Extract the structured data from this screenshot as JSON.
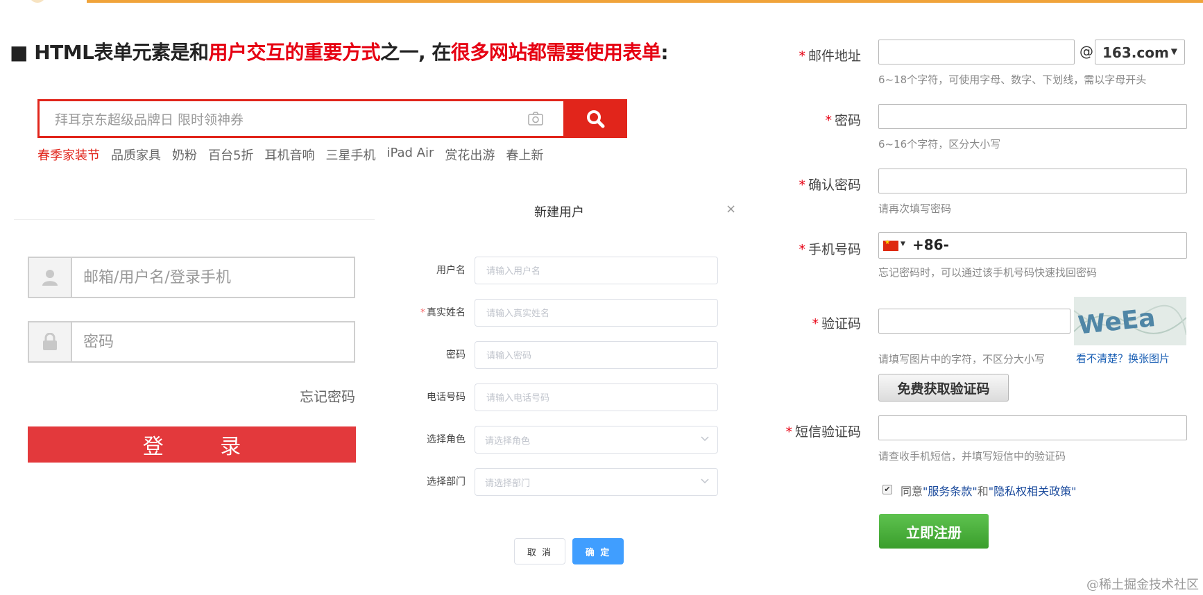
{
  "title": {
    "part1": "HTML表单元素是和",
    "part2": "用户交互的重要方式",
    "part3": "之一, 在",
    "part4": "很多网站都需要使用表单",
    "part5": ":"
  },
  "jd_search": {
    "placeholder": "拜耳京东超级品牌日 限时领神券",
    "hot_words": [
      "春季家装节",
      "品质家具",
      "奶粉",
      "百台5折",
      "耳机音响",
      "三星手机",
      "iPad Air",
      "赏花出游",
      "春上新"
    ]
  },
  "login": {
    "username_placeholder": "邮箱/用户名/登录手机",
    "password_placeholder": "密码",
    "forgot_password": "忘记密码",
    "login_button": "登 录"
  },
  "dialog": {
    "title": "新建用户",
    "close": "×",
    "fields": [
      {
        "label": "用户名",
        "required": false,
        "placeholder": "请输入用户名"
      },
      {
        "label": "真实姓名",
        "required": true,
        "placeholder": "请输入真实姓名"
      },
      {
        "label": "密码",
        "required": false,
        "placeholder": "请输入密码"
      },
      {
        "label": "电话号码",
        "required": false,
        "placeholder": "请输入电话号码"
      },
      {
        "label": "选择角色",
        "required": false,
        "placeholder": "请选择角色"
      },
      {
        "label": "选择部门",
        "required": false,
        "placeholder": "请选择部门"
      }
    ],
    "cancel": "取 消",
    "confirm": "确 定"
  },
  "register": {
    "email_label": "邮件地址",
    "email_at": "@",
    "email_domain": "163.com",
    "email_hint": "6~18个字符，可使用字母、数字、下划线，需以字母开头",
    "password_label": "密码",
    "password_hint": "6~16个字符，区分大小写",
    "confirm_label": "确认密码",
    "confirm_hint": "请再次填写密码",
    "phone_label": "手机号码",
    "phone_prefix": "+86-",
    "phone_hint": "忘记密码时，可以通过该手机号码快速找回密码",
    "captcha_label": "验证码",
    "captcha_hint": "请填写图片中的字符，不区分大小写",
    "captcha_refresh": "看不清楚？换张图片",
    "get_code_button": "免费获取验证码",
    "sms_label": "短信验证码",
    "sms_hint": "请查收手机短信，并填写短信中的验证码",
    "agree_prefix": "同意",
    "agree_terms": "\"服务条款\"",
    "agree_and": "和",
    "agree_privacy": "\"隐私权相关政策\"",
    "register_button": "立即注册",
    "required_mark": "*"
  },
  "watermark": "@稀土掘金技术社区",
  "colors": {
    "accent_red": "#e60012",
    "jd_red": "#e1251b",
    "login_red": "#e3393c",
    "dialog_blue": "#409eff",
    "register_green": "#3a9e2c",
    "top_bar": "#f0a33a"
  }
}
